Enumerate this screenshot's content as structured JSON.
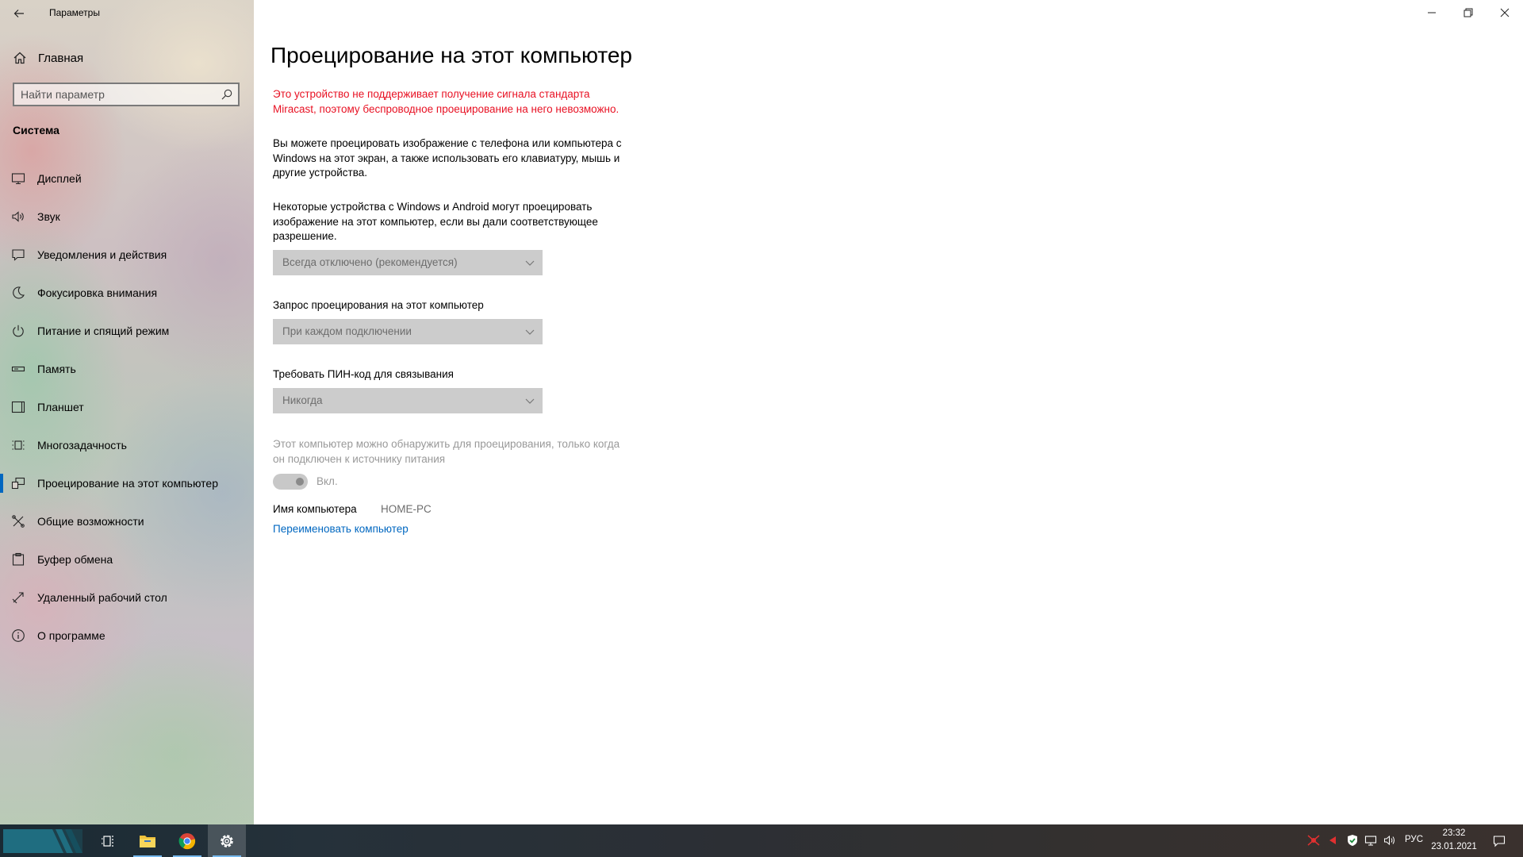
{
  "window": {
    "title": "Параметры"
  },
  "sidebar": {
    "home_label": "Главная",
    "search_placeholder": "Найти параметр",
    "section_title": "Система",
    "items": [
      {
        "label": "Дисплей",
        "icon": "monitor-icon"
      },
      {
        "label": "Звук",
        "icon": "speaker-icon"
      },
      {
        "label": "Уведомления и действия",
        "icon": "notification-icon"
      },
      {
        "label": "Фокусировка внимания",
        "icon": "moon-icon"
      },
      {
        "label": "Питание и спящий режим",
        "icon": "power-icon"
      },
      {
        "label": "Память",
        "icon": "storage-icon"
      },
      {
        "label": "Планшет",
        "icon": "tablet-icon"
      },
      {
        "label": "Многозадачность",
        "icon": "multitasking-icon"
      },
      {
        "label": "Проецирование на этот компьютер",
        "icon": "projecting-icon",
        "active": true
      },
      {
        "label": "Общие возможности",
        "icon": "shared-experiences-icon"
      },
      {
        "label": "Буфер обмена",
        "icon": "clipboard-icon"
      },
      {
        "label": "Удаленный рабочий стол",
        "icon": "remote-desktop-icon"
      },
      {
        "label": "О программе",
        "icon": "info-icon"
      }
    ]
  },
  "main": {
    "title": "Проецирование на этот компьютер",
    "error_message": "Это устройство не поддерживает получение сигнала стандарта Miracast, поэтому беспроводное проецирование на него невозможно.",
    "intro": "Вы можете проецировать изображение с телефона или компьютера с Windows на этот экран, а также использовать его клавиатуру, мышь и другие устройства.",
    "devices_description": "Некоторые устройства с Windows и Android могут проецировать изображение на этот компьютер, если вы дали соответствующее разрешение.",
    "availability_value": "Всегда отключено (рекомендуется)",
    "request_label": "Запрос проецирования на этот компьютер",
    "request_value": "При каждом подключении",
    "pin_label": "Требовать ПИН-код для связывания",
    "pin_value": "Никогда",
    "power_note": "Этот компьютер можно обнаружить для проецирования, только когда он подключен к источнику питания",
    "toggle_label": "Вкл.",
    "toggle_on": true,
    "pc_name_label": "Имя компьютера",
    "pc_name_value": "HOME-PC",
    "rename_link": "Переименовать компьютер"
  },
  "taskbar": {
    "apps": [
      "task-view",
      "file-explorer",
      "chrome",
      "settings"
    ],
    "language": "РУС",
    "time": "23:32",
    "date": "23.01.2021"
  },
  "colors": {
    "accent": "#0067c0",
    "error": "#e81123"
  }
}
